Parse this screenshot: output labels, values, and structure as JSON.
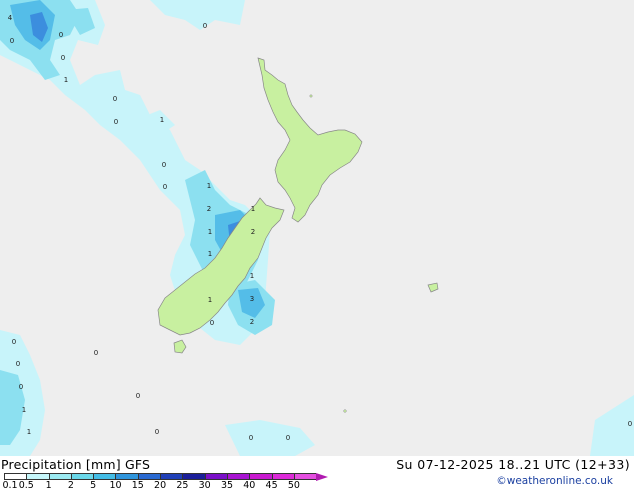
{
  "map": {
    "contour_labels": [
      "4",
      "0",
      "0",
      "0",
      "1",
      "0",
      "0",
      "1",
      "0",
      "0",
      "1",
      "2",
      "1",
      "1",
      "2",
      "1",
      "1",
      "3",
      "1",
      "0",
      "2",
      "0",
      "0",
      "0",
      "1",
      "0",
      "1",
      "0",
      "0",
      "0",
      "0",
      "0",
      "0"
    ]
  },
  "footer": {
    "title": "Precipitation [mm] GFS",
    "valid_time": "Su 07-12-2025 18..21 UTC (12+33)",
    "credit": "©weatheronline.co.uk",
    "scale_ticks": [
      "0.1",
      "0.5",
      "1",
      "2",
      "5",
      "10",
      "15",
      "20",
      "25",
      "30",
      "35",
      "40",
      "45",
      "50"
    ],
    "scale_colors": [
      "#ffffff",
      "#c6f6fa",
      "#9ceaf2",
      "#6ad8ea",
      "#44bde6",
      "#2f95dc",
      "#2a6ad2",
      "#2040b8",
      "#1b1f9a",
      "#7a10c8",
      "#a814d2",
      "#c81ad0",
      "#dc2ad8",
      "#e44ee0"
    ],
    "arrow_color": "#b01ab0"
  },
  "colors": {
    "background": "#eeeeee",
    "land": "#c8f0a0",
    "coast": "#888888",
    "precip_light": "#c8f4fa",
    "precip_mid": "#8ce0f0",
    "precip_heavy": "#54bde8",
    "precip_core": "#3c8ede"
  }
}
